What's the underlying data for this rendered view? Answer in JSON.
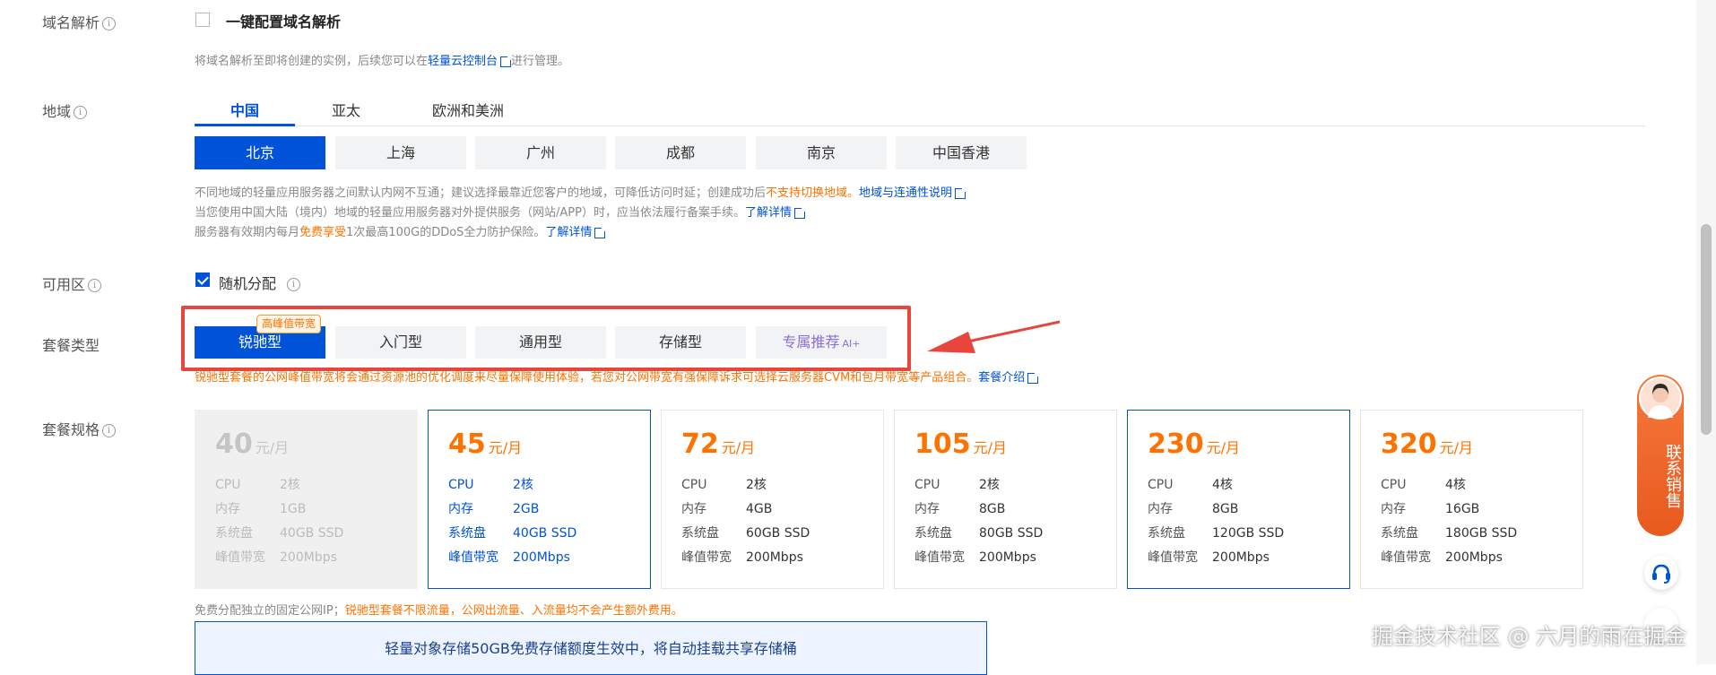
{
  "domain": {
    "label": "域名解析",
    "checkbox_label": "一键配置域名解析",
    "hint_prefix": "将域名解析至即将创建的实例，后续您可以在",
    "hint_link": "轻量云控制台",
    "hint_suffix": "进行管理。"
  },
  "region": {
    "label": "地域",
    "tabs": [
      "中国",
      "亚太",
      "欧洲和美洲"
    ],
    "cities": [
      "北京",
      "上海",
      "广州",
      "成都",
      "南京",
      "中国香港"
    ],
    "note1_prefix": "不同地域的轻量应用服务器之间默认内网不互通；建议选择最靠近您客户的地域，可降低访问时延；创建成功后",
    "note1_warn": "不支持切换地域。",
    "note1_link": "地域与连通性说明",
    "note2_prefix": "当您使用中国大陆（境内）地域的轻量应用服务器对外提供服务（网站/APP）时，应当依法履行备案手续。",
    "note2_link": "了解详情",
    "note3_prefix": "服务器有效期内每月",
    "note3_warn": "免费享受",
    "note3_suffix": "1次最高100G的DDoS全力防护保险。",
    "note3_link": "了解详情"
  },
  "zone": {
    "label": "可用区",
    "checkbox_label": "随机分配"
  },
  "package_type": {
    "label": "套餐类型",
    "badge": "高峰值带宽",
    "options": [
      "锐驰型",
      "入门型",
      "通用型",
      "存储型",
      "专属推荐"
    ],
    "ai_tag": "AI+",
    "note": "锐驰型套餐的公网峰值带宽将会通过资源池的优化调度来尽量保障使用体验，若您对公网带宽有强保障诉求可选择云服务器CVM和包月带宽等产品组合。",
    "note_link": "套餐介绍"
  },
  "spec": {
    "label": "套餐规格",
    "unit": "元/月",
    "keys": [
      "CPU",
      "内存",
      "系统盘",
      "峰值带宽"
    ],
    "cards": [
      {
        "price": "40",
        "cpu": "2核",
        "mem": "1GB",
        "disk": "40GB SSD",
        "bw": "200Mbps"
      },
      {
        "price": "45",
        "cpu": "2核",
        "mem": "2GB",
        "disk": "40GB SSD",
        "bw": "200Mbps"
      },
      {
        "price": "72",
        "cpu": "2核",
        "mem": "4GB",
        "disk": "60GB SSD",
        "bw": "200Mbps"
      },
      {
        "price": "105",
        "cpu": "2核",
        "mem": "8GB",
        "disk": "80GB SSD",
        "bw": "200Mbps"
      },
      {
        "price": "230",
        "cpu": "4核",
        "mem": "8GB",
        "disk": "120GB SSD",
        "bw": "200Mbps"
      },
      {
        "price": "320",
        "cpu": "4核",
        "mem": "16GB",
        "disk": "180GB SSD",
        "bw": "200Mbps"
      }
    ],
    "footer_prefix": "免费分配独立的固定公网IP；",
    "footer_warn": "锐驰型套餐不限流量，公网出流量、入流量均不会产生额外费用。",
    "banner": "轻量对象存储50GB免费存储额度生效中，将自动挂载共享存储桶"
  },
  "sidebar": {
    "contact_sales": "联系销售"
  },
  "watermark": "掘金技术社区 @ 六月的雨在掘金",
  "colors": {
    "primary": "#0052d9",
    "orange": "#ff7200",
    "red_box": "#e8453c"
  }
}
